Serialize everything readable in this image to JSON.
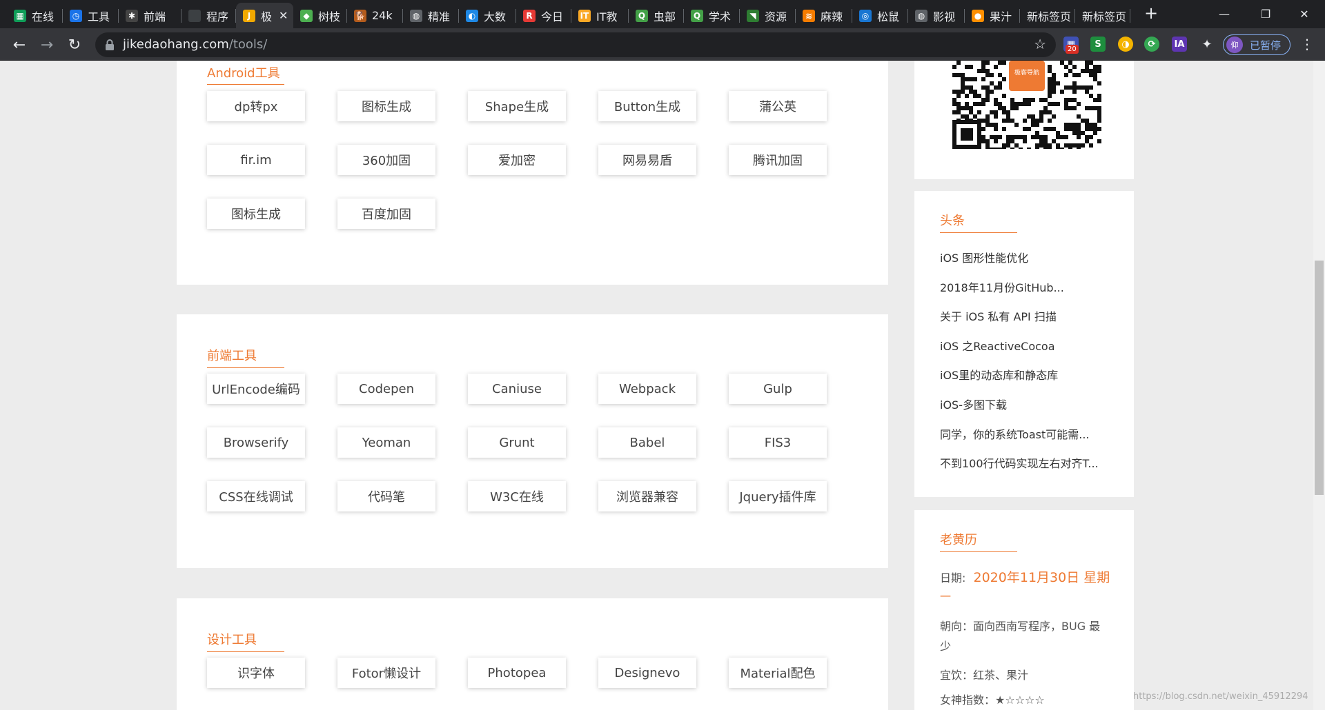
{
  "browser": {
    "tabs": [
      {
        "label": "在线",
        "color": "#0f9d58",
        "glyph": "▦"
      },
      {
        "label": "工具",
        "color": "#1a73e8",
        "glyph": "◷"
      },
      {
        "label": "前端",
        "color": "#444444",
        "glyph": "✱"
      },
      {
        "label": "程序",
        "color": "#3c4043",
        "glyph": ""
      },
      {
        "label": "极",
        "color": "#f2a900",
        "glyph": "J"
      },
      {
        "label": "树枝",
        "color": "#4caf50",
        "glyph": "◆"
      },
      {
        "label": "24k",
        "color": "#b35b1c",
        "glyph": "🐕"
      },
      {
        "label": "精准",
        "color": "#5f6368",
        "glyph": "◍"
      },
      {
        "label": "大数",
        "color": "#1e88e5",
        "glyph": "◐"
      },
      {
        "label": "今日",
        "color": "#e53935",
        "glyph": "R"
      },
      {
        "label": "IT教",
        "color": "#f9a825",
        "glyph": "IT"
      },
      {
        "label": "虫部",
        "color": "#43a047",
        "glyph": "Q"
      },
      {
        "label": "学术",
        "color": "#43a047",
        "glyph": "Q"
      },
      {
        "label": "资源",
        "color": "#2e7d32",
        "glyph": "◥"
      },
      {
        "label": "麻辣",
        "color": "#f57c00",
        "glyph": "≋"
      },
      {
        "label": "松鼠",
        "color": "#1976d2",
        "glyph": "◎"
      },
      {
        "label": "影视",
        "color": "#5f6368",
        "glyph": "◍"
      },
      {
        "label": "果汁",
        "color": "#ff8f00",
        "glyph": "●"
      },
      {
        "label": "新标签页",
        "color": "",
        "glyph": ""
      },
      {
        "label": "新标签页",
        "color": "",
        "glyph": ""
      }
    ],
    "new_tab": "+",
    "window_controls": [
      "—",
      "❐",
      "✕"
    ],
    "url_host": "jikedaohang.com",
    "url_path": "/tools/",
    "extension_badge": "20",
    "profile_label": "已暂停",
    "profile_avatar": "仰",
    "icons": [
      "back-icon",
      "forward-icon",
      "reload-icon",
      "lock-icon",
      "bookmark-star-icon",
      "extensions-icon",
      "menu-icon"
    ]
  },
  "sections": [
    {
      "title": "Android工具",
      "tools": [
        "dp转px",
        "图标生成",
        "Shape生成",
        "Button生成",
        "蒲公英",
        "fir.im",
        "360加固",
        "爱加密",
        "网易易盾",
        "腾讯加固",
        "图标生成",
        "百度加固"
      ]
    },
    {
      "title": "前端工具",
      "tools": [
        "UrlEncode编码",
        "Codepen",
        "Caniuse",
        "Webpack",
        "Gulp",
        "Browserify",
        "Yeoman",
        "Grunt",
        "Babel",
        "FIS3",
        "CSS在线调试",
        "代码笔",
        "W3C在线",
        "浏览器兼容",
        "Jquery插件库"
      ]
    },
    {
      "title": "设计工具",
      "tools": [
        "识字体",
        "Fotor懒设计",
        "Photopea",
        "Designevo",
        "Material配色"
      ]
    }
  ],
  "headlines": {
    "title": "头条",
    "items": [
      "iOS 图形性能优化",
      "2018年11月份GitHub...",
      "关于 iOS 私有 API 扫描",
      "iOS 之ReactiveCocoa",
      "iOS里的动态库和静态库",
      "iOS-多图下载",
      "同学，你的系统Toast可能需...",
      "不到100行代码实现左右对齐T..."
    ]
  },
  "almanac": {
    "title": "老黄历",
    "date_label": "日期:",
    "date_value": "2020年11月30日 星期",
    "date_overflow": "一",
    "direction": "朝向：面向西南写程序，BUG 最",
    "direction_overflow": "少",
    "suitable": "宜饮：红茶、果汁",
    "goddess": "女神指数：★☆☆☆☆"
  },
  "qr_logo_text": "极客导航",
  "watermark": "https://blog.csdn.net/weixin_45912294",
  "colors": {
    "accent": "#ee7a33",
    "tab_bg": "#202124",
    "toolbar_bg": "#35363a",
    "page_bg": "#ececec"
  }
}
